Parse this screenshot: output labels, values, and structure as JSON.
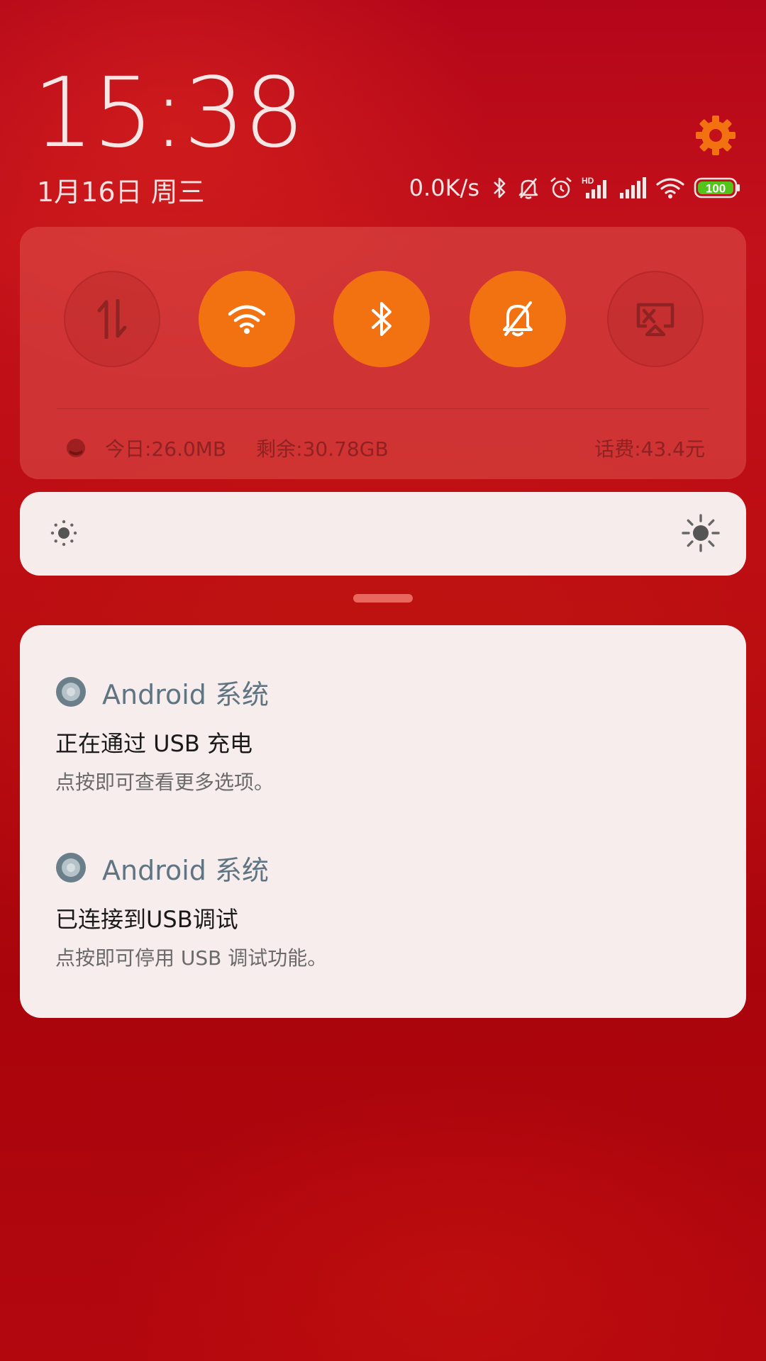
{
  "header": {
    "time": "15:38",
    "date": "1月16日 周三",
    "settings_icon": "gear-icon",
    "accent_color": "#f27111"
  },
  "status_bar": {
    "net_speed": "0.0K/s",
    "icons": [
      "bluetooth-icon",
      "mute-bell-icon",
      "alarm-icon",
      "hd-signal-icon",
      "signal-icon",
      "wifi-icon",
      "battery-icon"
    ],
    "hd_label": "HD",
    "battery_level": "100"
  },
  "quick_settings": {
    "toggles": [
      {
        "name": "mobile-data",
        "icon": "data-arrows-icon",
        "active": false
      },
      {
        "name": "wifi",
        "icon": "wifi-icon",
        "active": true
      },
      {
        "name": "bluetooth",
        "icon": "bluetooth-icon",
        "active": true
      },
      {
        "name": "silent",
        "icon": "mute-bell-icon",
        "active": true
      },
      {
        "name": "screencast",
        "icon": "cast-icon",
        "active": false
      }
    ],
    "data_usage": {
      "today": "今日:26.0MB",
      "remaining": "剩余:30.78GB",
      "fee": "话费:43.4元"
    }
  },
  "brightness": {
    "low_icon": "brightness-low-icon",
    "high_icon": "brightness-high-icon"
  },
  "notifications": [
    {
      "app": "Android 系统",
      "title": "正在通过 USB 充电",
      "text": "点按即可查看更多选项。"
    },
    {
      "app": "Android 系统",
      "title": "已连接到USB调试",
      "text": "点按即可停用 USB 调试功能。"
    }
  ]
}
